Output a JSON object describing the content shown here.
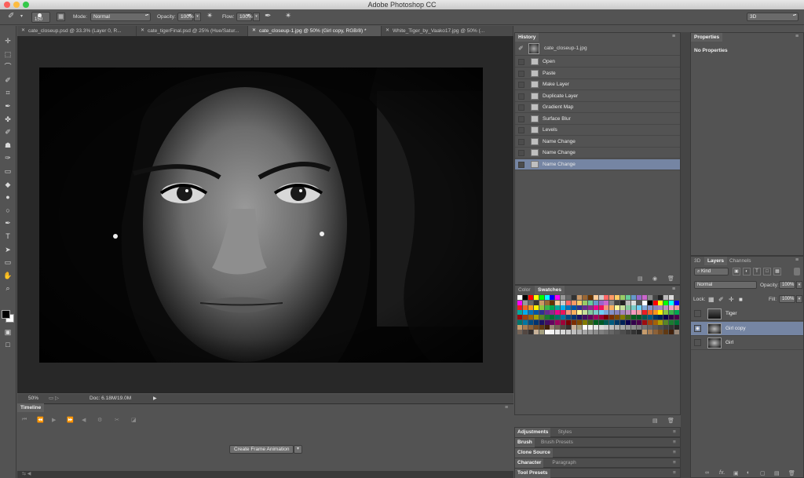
{
  "app": {
    "title": "Adobe Photoshop CC"
  },
  "options": {
    "brush_size": "150",
    "mode_label": "Mode:",
    "mode_value": "Normal",
    "opacity_label": "Opacity:",
    "opacity_value": "100%",
    "flow_label": "Flow:",
    "flow_value": "100%",
    "workspace_value": "3D"
  },
  "tabs": [
    {
      "label": "cate_closeup.psd @ 33.3% (Layer 0, R...",
      "active": false
    },
    {
      "label": "cate_tigerFinal.psd @ 25% (Hue/Satur...",
      "active": false
    },
    {
      "label": "cate_closeup-1.jpg @ 50% (Girl copy, RGB/8) *",
      "active": true
    },
    {
      "label": "White_Tiger_by_Vaako17.jpg @ 50% (...",
      "active": false
    }
  ],
  "tools": [
    "move-tool-icon",
    "marquee-tool-icon",
    "lasso-tool-icon",
    "quick-select-tool-icon",
    "crop-tool-icon",
    "eyedropper-tool-icon",
    "healing-brush-tool-icon",
    "brush-tool-icon",
    "clone-stamp-tool-icon",
    "history-brush-tool-icon",
    "eraser-tool-icon",
    "paint-bucket-tool-icon",
    "blur-tool-icon",
    "dodge-tool-icon",
    "pen-tool-icon",
    "type-tool-icon",
    "path-select-tool-icon",
    "shape-tool-icon",
    "hand-tool-icon",
    "zoom-tool-icon"
  ],
  "colors": {
    "foreground": "#000000",
    "background": "#ffffff",
    "accent": "#7585a3"
  },
  "status": {
    "zoom": "50%",
    "doc_info": "Doc: 6.18M/19.0M"
  },
  "timeline": {
    "tab_label": "Timeline",
    "create_button": "Create Frame Animation"
  },
  "history": {
    "tab_label": "History",
    "snapshot_label": "cate_closeup-1.jpg",
    "items": [
      "Open",
      "Paste",
      "Make Layer",
      "Duplicate Layer",
      "Gradient Map",
      "Surface Blur",
      "Levels",
      "Name Change",
      "Name Change",
      "Name Change"
    ],
    "selected_index": 9
  },
  "swatch_panel": {
    "tab_color": "Color",
    "tab_swatches": "Swatches"
  },
  "swatches": [
    [
      "#ffffff",
      "#000000",
      "#ff0000",
      "#ffff00",
      "#00ff00",
      "#00ffff",
      "#0000ff",
      "#ff00ff",
      "#999999",
      "#666666",
      "#333333",
      "#cc9966",
      "#996633",
      "#663300",
      "#ffcc99",
      "#cccccc",
      "#ff6666",
      "#ff9966",
      "#ffcc66",
      "#99cc66",
      "#66cc99",
      "#6699cc",
      "#9966cc",
      "#cc66cc",
      "#888888",
      "#444444",
      "#222222",
      "#bbbbbb",
      "#dddddd",
      "#555555"
    ],
    [
      "#ed1c24",
      "#f26522",
      "#f7941d",
      "#fff200",
      "#8dc63f",
      "#39b54a",
      "#00a651",
      "#00a99d",
      "#00aeef",
      "#0072bc",
      "#0054a6",
      "#2e3192",
      "#662d91",
      "#92278f",
      "#ec008c",
      "#ed145b",
      "#f69679",
      "#fbaf5d",
      "#fff799",
      "#c4df9b",
      "#82ca9c",
      "#7accc8",
      "#6dcff6",
      "#7da7d9",
      "#8393ca",
      "#8781bd",
      "#a186be",
      "#bd8cbf",
      "#f49ac1",
      "#f5989d"
    ],
    [
      "#9e0b0f",
      "#a0410d",
      "#a36209",
      "#aba000",
      "#598527",
      "#1a7b30",
      "#007236",
      "#00746b",
      "#0076a3",
      "#004a80",
      "#003471",
      "#1b1464",
      "#440e62",
      "#630460",
      "#9e005d",
      "#9e0039",
      "#790000",
      "#7b2e00",
      "#7d4900",
      "#827b00",
      "#406618",
      "#005e20",
      "#005826",
      "#005952",
      "#005b7f",
      "#003663",
      "#002157",
      "#0d004c",
      "#32004b",
      "#4b0049"
    ],
    [
      "#c69c6d",
      "#a67c52",
      "#8c6239",
      "#754c24",
      "#603913",
      "#42210b",
      "#998675",
      "#736357",
      "#534741",
      "#362f2d",
      "#c7b299",
      "#a39e7d",
      "#ffffff",
      "#f2f2f2",
      "#e6e6e6",
      "#d9d9d9",
      "#cccccc",
      "#bfbfbf",
      "#b3b3b3",
      "#a6a6a6",
      "#999999",
      "#8c8c8c",
      "#808080",
      "#737373",
      "#666666",
      "#595959",
      "#4d4d4d",
      "#404040",
      "#333333",
      "#262626"
    ]
  ],
  "mini_panels": [
    {
      "a": "Adjustments",
      "b": "Styles"
    },
    {
      "a": "Brush",
      "b": "Brush Presets"
    },
    {
      "a": "Clone Source",
      "b": ""
    },
    {
      "a": "Character",
      "b": "Paragraph"
    },
    {
      "a": "Tool Presets",
      "b": ""
    }
  ],
  "properties": {
    "tab_label": "Properties",
    "content": "No Properties"
  },
  "layers": {
    "tab_3d": "3D",
    "tab_layers": "Layers",
    "tab_channels": "Channels",
    "filter_kind": "Kind",
    "blend_mode": "Normal",
    "opacity_label": "Opacity:",
    "opacity_value": "100%",
    "lock_label": "Lock:",
    "fill_label": "Fill:",
    "fill_value": "100%",
    "items": [
      {
        "name": "Tiger",
        "visible": false,
        "selected": false
      },
      {
        "name": "Girl copy",
        "visible": true,
        "selected": true
      },
      {
        "name": "Girl",
        "visible": false,
        "selected": false
      }
    ]
  }
}
